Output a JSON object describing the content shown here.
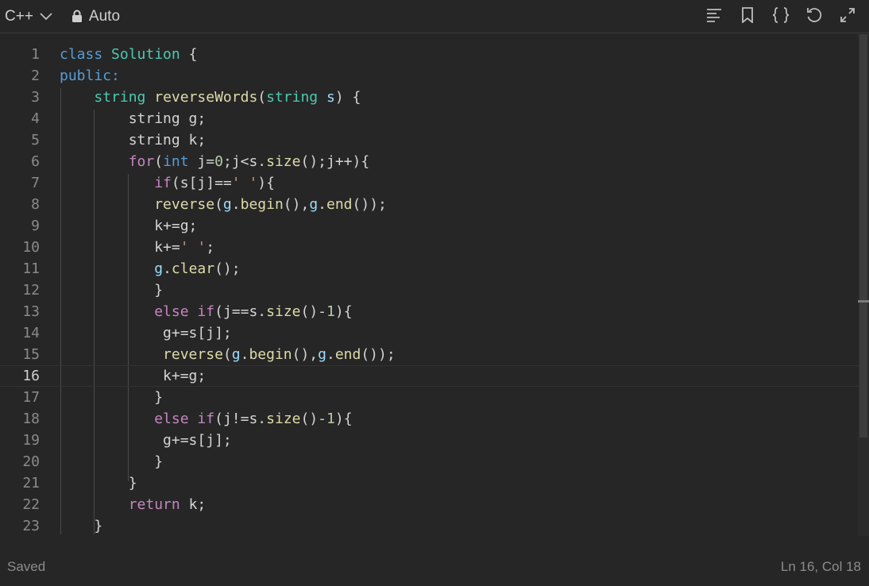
{
  "toolbar": {
    "language": "C++",
    "mode": "Auto",
    "icons": [
      "format-icon",
      "bookmark-icon",
      "braces-icon",
      "reset-icon",
      "expand-icon"
    ]
  },
  "editor": {
    "current_line": 16,
    "lines": [
      {
        "n": "1",
        "t": [
          [
            "kw",
            "class"
          ],
          [
            "p",
            " "
          ],
          [
            "ty",
            "Solution"
          ],
          [
            "p",
            " {"
          ]
        ]
      },
      {
        "n": "2",
        "t": [
          [
            "kw",
            "public"
          ],
          [
            "kw",
            ":"
          ]
        ]
      },
      {
        "n": "3",
        "t": [
          [
            "p",
            "    "
          ],
          [
            "ty",
            "string"
          ],
          [
            "p",
            " "
          ],
          [
            "fn",
            "reverseWords"
          ],
          [
            "p",
            "("
          ],
          [
            "ty",
            "string"
          ],
          [
            "p",
            " "
          ],
          [
            "var",
            "s"
          ],
          [
            "p",
            ") {"
          ]
        ]
      },
      {
        "n": "4",
        "t": [
          [
            "p",
            "        string g;"
          ]
        ]
      },
      {
        "n": "5",
        "t": [
          [
            "p",
            "        string k;"
          ]
        ]
      },
      {
        "n": "6",
        "t": [
          [
            "p",
            "        "
          ],
          [
            "ctl",
            "for"
          ],
          [
            "p",
            "("
          ],
          [
            "kw",
            "int"
          ],
          [
            "p",
            " j="
          ],
          [
            "num",
            "0"
          ],
          [
            "p",
            ";j<s."
          ],
          [
            "fn",
            "size"
          ],
          [
            "p",
            "();j++){"
          ]
        ]
      },
      {
        "n": "7",
        "t": [
          [
            "p",
            "           "
          ],
          [
            "ctl",
            "if"
          ],
          [
            "p",
            "(s[j]=="
          ],
          [
            "str",
            "' '"
          ],
          [
            "p",
            "){"
          ]
        ]
      },
      {
        "n": "8",
        "t": [
          [
            "p",
            "           "
          ],
          [
            "fn",
            "reverse"
          ],
          [
            "p",
            "("
          ],
          [
            "var",
            "g"
          ],
          [
            "p",
            "."
          ],
          [
            "fn",
            "begin"
          ],
          [
            "p",
            "(),"
          ],
          [
            "var",
            "g"
          ],
          [
            "p",
            "."
          ],
          [
            "fn",
            "end"
          ],
          [
            "p",
            "());"
          ]
        ]
      },
      {
        "n": "9",
        "t": [
          [
            "p",
            "           k+=g;"
          ]
        ]
      },
      {
        "n": "10",
        "t": [
          [
            "p",
            "           k+="
          ],
          [
            "str",
            "' '"
          ],
          [
            "p",
            ";"
          ]
        ]
      },
      {
        "n": "11",
        "t": [
          [
            "p",
            "           "
          ],
          [
            "var",
            "g"
          ],
          [
            "p",
            "."
          ],
          [
            "fn",
            "clear"
          ],
          [
            "p",
            "();"
          ]
        ]
      },
      {
        "n": "12",
        "t": [
          [
            "p",
            "           }"
          ]
        ]
      },
      {
        "n": "13",
        "t": [
          [
            "p",
            "           "
          ],
          [
            "ctl",
            "else"
          ],
          [
            "p",
            " "
          ],
          [
            "ctl",
            "if"
          ],
          [
            "p",
            "(j==s."
          ],
          [
            "fn",
            "size"
          ],
          [
            "p",
            "()-"
          ],
          [
            "num",
            "1"
          ],
          [
            "p",
            "){"
          ]
        ]
      },
      {
        "n": "14",
        "t": [
          [
            "p",
            "            g+=s[j];"
          ]
        ]
      },
      {
        "n": "15",
        "t": [
          [
            "p",
            "            "
          ],
          [
            "fn",
            "reverse"
          ],
          [
            "p",
            "("
          ],
          [
            "var",
            "g"
          ],
          [
            "p",
            "."
          ],
          [
            "fn",
            "begin"
          ],
          [
            "p",
            "(),"
          ],
          [
            "var",
            "g"
          ],
          [
            "p",
            "."
          ],
          [
            "fn",
            "end"
          ],
          [
            "p",
            "());"
          ]
        ]
      },
      {
        "n": "16",
        "t": [
          [
            "p",
            "            k+=g;"
          ]
        ]
      },
      {
        "n": "17",
        "t": [
          [
            "p",
            "           }"
          ]
        ]
      },
      {
        "n": "18",
        "t": [
          [
            "p",
            "           "
          ],
          [
            "ctl",
            "else"
          ],
          [
            "p",
            " "
          ],
          [
            "ctl",
            "if"
          ],
          [
            "p",
            "(j!=s."
          ],
          [
            "fn",
            "size"
          ],
          [
            "p",
            "()-"
          ],
          [
            "num",
            "1"
          ],
          [
            "p",
            "){"
          ]
        ]
      },
      {
        "n": "19",
        "t": [
          [
            "p",
            "            g+=s[j];"
          ]
        ]
      },
      {
        "n": "20",
        "t": [
          [
            "p",
            "           }"
          ]
        ]
      },
      {
        "n": "21",
        "t": [
          [
            "p",
            "        }"
          ]
        ]
      },
      {
        "n": "22",
        "t": [
          [
            "p",
            "        "
          ],
          [
            "ctl",
            "return"
          ],
          [
            "p",
            " k;"
          ]
        ]
      },
      {
        "n": "23",
        "t": [
          [
            "p",
            "    }"
          ]
        ]
      }
    ]
  },
  "status": {
    "saved": "Saved",
    "position": "Ln 16, Col 18"
  }
}
